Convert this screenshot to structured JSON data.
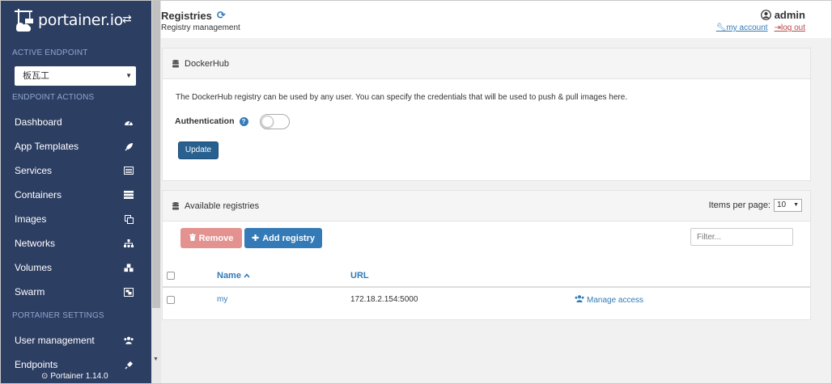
{
  "sidebar": {
    "brand": "portainer.io",
    "active_endpoint_heading": "ACTIVE ENDPOINT",
    "endpoint_value": "板瓦工",
    "endpoint_actions_heading": "ENDPOINT ACTIONS",
    "items": [
      {
        "label": "Dashboard",
        "icon": "tachometer-icon"
      },
      {
        "label": "App Templates",
        "icon": "rocket-icon"
      },
      {
        "label": "Services",
        "icon": "list-alt-icon"
      },
      {
        "label": "Containers",
        "icon": "server-icon"
      },
      {
        "label": "Images",
        "icon": "clone-icon"
      },
      {
        "label": "Networks",
        "icon": "sitemap-icon"
      },
      {
        "label": "Volumes",
        "icon": "cubes-icon"
      },
      {
        "label": "Swarm",
        "icon": "object-group-icon"
      }
    ],
    "settings_heading": "PORTAINER SETTINGS",
    "settings_items": [
      {
        "label": "User management",
        "icon": "users-icon"
      },
      {
        "label": "Endpoints",
        "icon": "plug-icon"
      }
    ],
    "version": "Portainer 1.14.0"
  },
  "header": {
    "title": "Registries",
    "subtitle": "Registry management",
    "username": "admin",
    "my_account": "my account",
    "log_out": "log out"
  },
  "dockerhub_panel": {
    "title": "DockerHub",
    "description": "The DockerHub registry can be used by any user. You can specify the credentials that will be used to push & pull images here.",
    "auth_label": "Authentication",
    "update_label": "Update"
  },
  "registries_panel": {
    "title": "Available registries",
    "items_per_page_label": "Items per page:",
    "items_per_page_value": "10",
    "remove_label": "Remove",
    "add_label": "Add registry",
    "filter_placeholder": "Filter...",
    "columns": {
      "name": "Name",
      "url": "URL"
    },
    "rows": [
      {
        "name": "my",
        "url": "172.18.2.154:5000",
        "access": "Manage access"
      }
    ]
  },
  "colors": {
    "sidebar_bg": "#2d3e63",
    "primary": "#337ab7",
    "danger_light": "#e3928f"
  }
}
